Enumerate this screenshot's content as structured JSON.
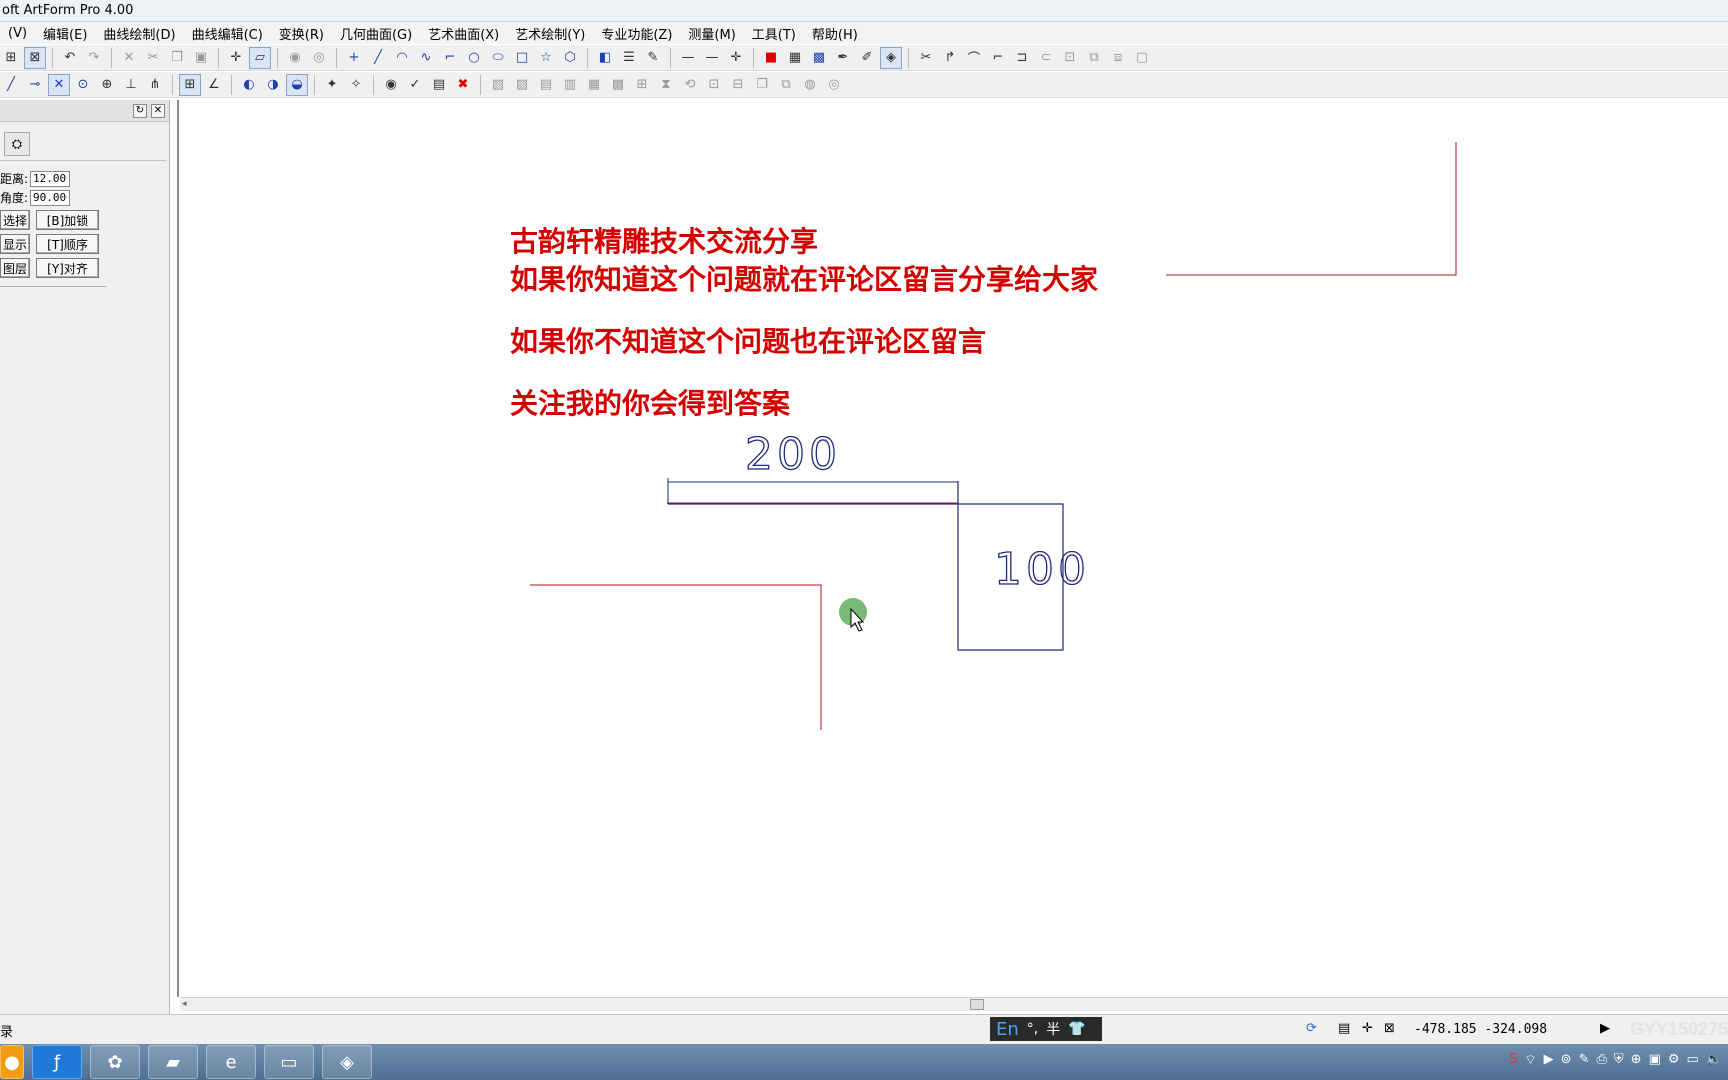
{
  "window": {
    "title": "oft ArtForm Pro 4.00"
  },
  "menu": [
    "(V)",
    "编辑(E)",
    "曲线绘制(D)",
    "曲线编辑(C)",
    "变换(R)",
    "几何曲面(G)",
    "艺术曲面(X)",
    "艺术绘制(Y)",
    "专业功能(Z)",
    "测量(M)",
    "工具(T)",
    "帮助(H)"
  ],
  "panel": {
    "distance_label": "距离:",
    "distance_value": "12.000",
    "angle_label": "角度:",
    "angle_value": "90.000",
    "btn_select": "选择",
    "btn_lock": "[B]加锁",
    "btn_show": "显示",
    "btn_order": "[T]顺序",
    "btn_layer": "图层",
    "btn_align": "[Y]对齐"
  },
  "canvas": {
    "lines": [
      "古韵轩精雕技术交流分享",
      "如果你知道这个问题就在评论区留言分享给大家",
      "如果你不知道这个问题也在评论区留言",
      "关注我的你会得到答案"
    ],
    "dim_horizontal": "200",
    "dim_vertical": "100",
    "colors": {
      "text": "#d40000",
      "red_line": "#b0132a",
      "blue_line": "#1f2a7a"
    }
  },
  "status": {
    "left_text": "录",
    "ime_lang": "En",
    "ime_mode": "半",
    "coords": "-478.185 -324.098",
    "watermark": "GYY15027555"
  }
}
